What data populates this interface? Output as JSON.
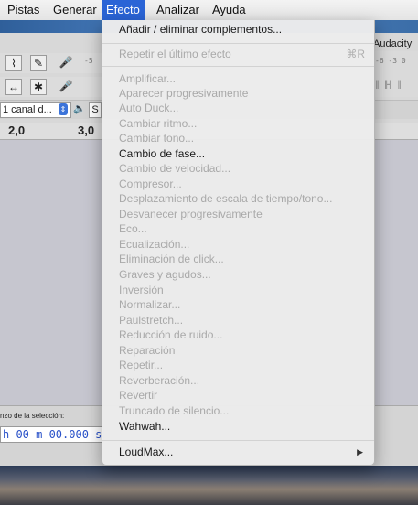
{
  "menubar": {
    "items": [
      {
        "label": "Pistas",
        "active": false
      },
      {
        "label": "Generar",
        "active": false
      },
      {
        "label": "Efecto",
        "active": true
      },
      {
        "label": "Analizar",
        "active": false
      },
      {
        "label": "Ayuda",
        "active": false
      }
    ]
  },
  "window": {
    "title_fragment": "Audacity"
  },
  "toolbar": {
    "device": "1 canal d...",
    "playback_letter": "S"
  },
  "ruler": {
    "labels": [
      "2,0",
      "3,0"
    ]
  },
  "selection": {
    "label": "nzo de la selección:",
    "time": "h 00 m 00.000 s"
  },
  "effect_menu": {
    "items": [
      {
        "label": "Añadir / eliminar complementos...",
        "enabled": true
      },
      {
        "label": "Repetir el último efecto",
        "enabled": false,
        "shortcut": "⌘R"
      },
      {
        "label": "Amplificar...",
        "enabled": false
      },
      {
        "label": "Aparecer progresivamente",
        "enabled": false
      },
      {
        "label": "Auto Duck...",
        "enabled": false
      },
      {
        "label": "Cambiar ritmo...",
        "enabled": false
      },
      {
        "label": "Cambiar tono...",
        "enabled": false
      },
      {
        "label": "Cambio de fase...",
        "enabled": true
      },
      {
        "label": "Cambio de velocidad...",
        "enabled": false
      },
      {
        "label": "Compresor...",
        "enabled": false
      },
      {
        "label": "Desplazamiento de escala de tiempo/tono...",
        "enabled": false
      },
      {
        "label": "Desvanecer progresivamente",
        "enabled": false
      },
      {
        "label": "Eco...",
        "enabled": false
      },
      {
        "label": "Ecualización...",
        "enabled": false
      },
      {
        "label": "Eliminación de click...",
        "enabled": false
      },
      {
        "label": "Graves y agudos...",
        "enabled": false
      },
      {
        "label": "Inversión",
        "enabled": false
      },
      {
        "label": "Normalizar...",
        "enabled": false
      },
      {
        "label": "Paulstretch...",
        "enabled": false
      },
      {
        "label": "Reducción de ruido...",
        "enabled": false
      },
      {
        "label": "Reparación",
        "enabled": false
      },
      {
        "label": "Repetir...",
        "enabled": false
      },
      {
        "label": "Reverberación...",
        "enabled": false
      },
      {
        "label": "Revertir",
        "enabled": false
      },
      {
        "label": "Truncado de silencio...",
        "enabled": false
      },
      {
        "label": "Wahwah...",
        "enabled": true
      },
      {
        "label": "LoudMax...",
        "enabled": true,
        "submenu": true
      }
    ]
  }
}
